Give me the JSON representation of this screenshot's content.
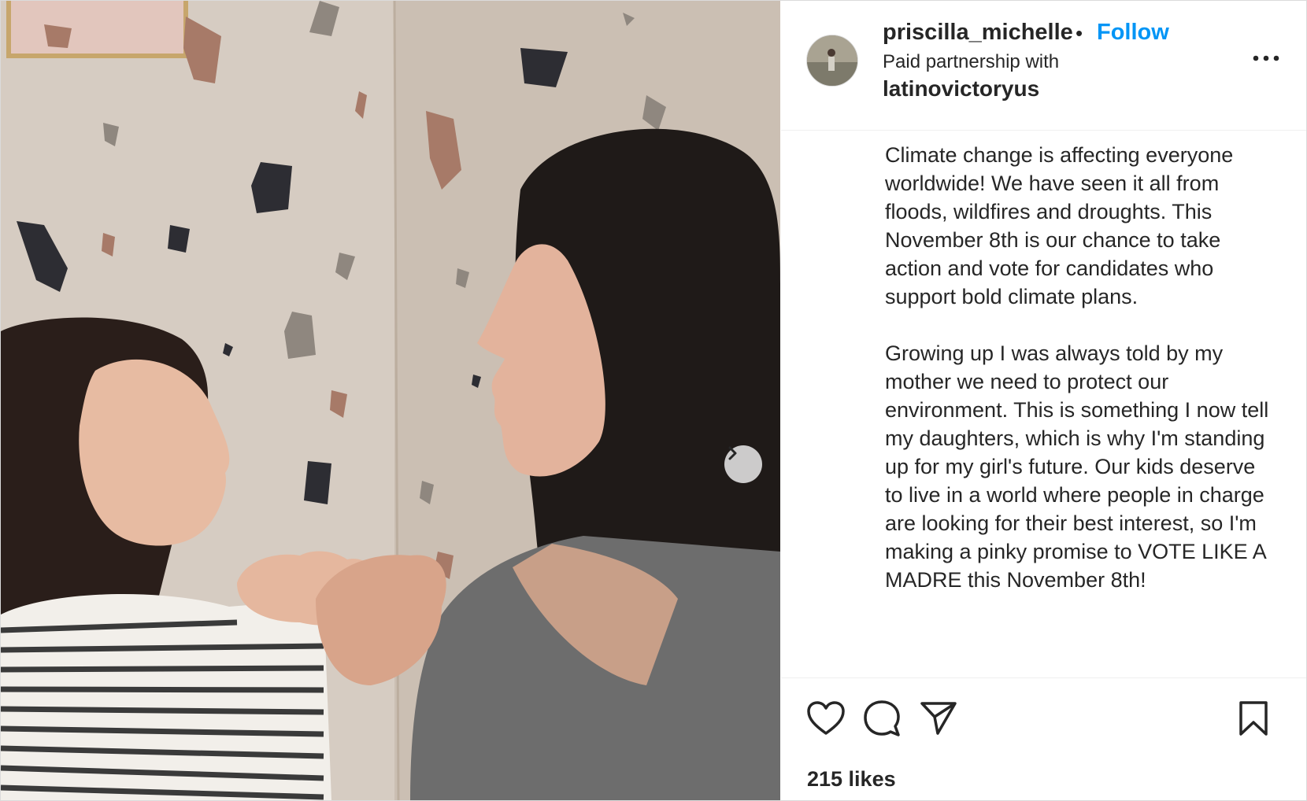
{
  "post": {
    "photo_alt": "",
    "carousel_next_icon": "chevron-right-icon"
  },
  "header": {
    "username": "priscilla_michelle",
    "separator": "•",
    "follow_label": "Follow",
    "partnership_label": "Paid partnership with",
    "partner_account": "latinovictoryus",
    "more_icon": "more-options-icon"
  },
  "caption": {
    "paragraphs": [
      "Climate change is affecting everyone worldwide! We have seen it all from floods, wildfires and droughts. This November 8th is our chance to take action and vote for candidates who support bold climate plans.",
      "Growing up I was always told by my mother we need to protect our environment. This is something I now tell my daughters, which is why I'm standing up for my girl's future. Our kids deserve to live in a world where people in charge are looking for their best interest, so I'm making a pinky promise to VOTE LIKE A MADRE this November 8th!"
    ]
  },
  "actions": {
    "like_icon": "heart-icon",
    "comment_icon": "comment-icon",
    "share_icon": "share-icon",
    "save_icon": "bookmark-icon"
  },
  "likes": "215 likes",
  "colors": {
    "accent": "#0095f6",
    "text": "#262626",
    "border": "#dbdbdb"
  }
}
